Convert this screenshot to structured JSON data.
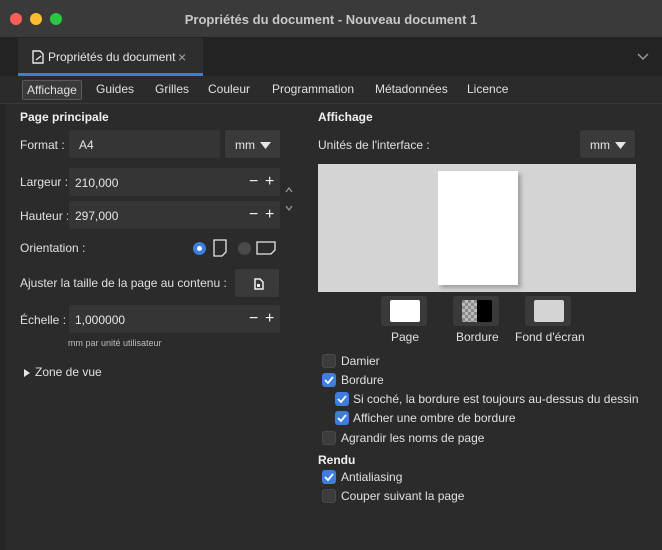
{
  "window": {
    "title": "Propriétés du document - Nouveau document 1"
  },
  "doc_tab": {
    "label": "Propriétés du document",
    "close": "×"
  },
  "subtabs": [
    "Affichage",
    "Guides",
    "Grilles",
    "Couleur",
    "Programmation",
    "Métadonnées",
    "Licence"
  ],
  "page_section": {
    "title": "Page principale",
    "format": {
      "label": "Format :",
      "value": "A4",
      "unit": "mm"
    },
    "width": {
      "label": "Largeur :",
      "value": "210,000"
    },
    "height": {
      "label": "Hauteur :",
      "value": "297,000"
    },
    "orientation": {
      "label": "Orientation :",
      "selected": "portrait"
    },
    "fit_label": "Ajuster la taille de la page au contenu :",
    "scale": {
      "label": "Échelle :",
      "value": "1,000000",
      "hint": "mm par unité utilisateur"
    },
    "viewbox_label": "Zone de vue"
  },
  "display_section": {
    "title": "Affichage",
    "units_label": "Unités de l'interface :",
    "units_value": "mm",
    "swatches": [
      {
        "label": "Page",
        "color": "#ffffff"
      },
      {
        "label": "Bordure",
        "color": "#000000"
      },
      {
        "label": "Fond d'écran",
        "color": "#d4d4d4"
      }
    ],
    "checkboxes": [
      {
        "label": "Damier",
        "checked": false
      },
      {
        "label": "Bordure",
        "checked": true
      },
      {
        "label": "Si coché, la bordure est toujours au-dessus du dessin",
        "checked": true
      },
      {
        "label": "Afficher une ombre de bordure",
        "checked": true
      },
      {
        "label": "Agrandir les noms de page",
        "checked": false
      }
    ]
  },
  "render_section": {
    "title": "Rendu",
    "checkboxes": [
      {
        "label": "Antialiasing",
        "checked": true
      },
      {
        "label": "Couper suivant la page",
        "checked": false
      }
    ]
  },
  "colors": {
    "accent": "#3d7ddb",
    "panel": "#2b2b2b",
    "field": "#353535"
  }
}
